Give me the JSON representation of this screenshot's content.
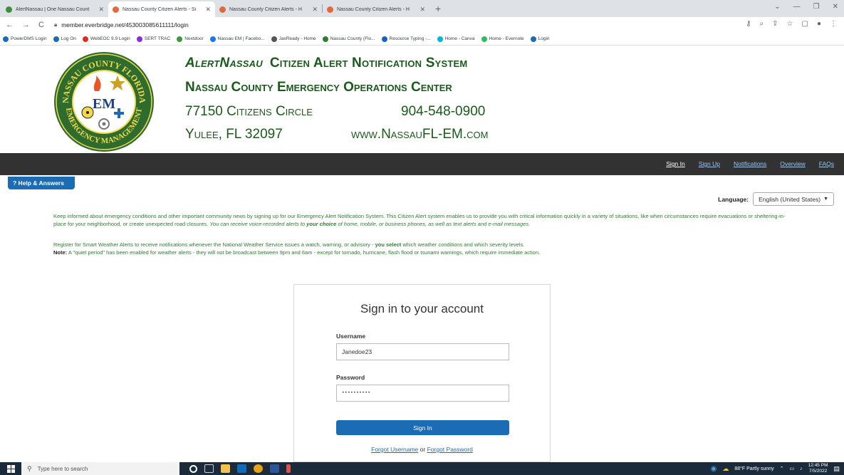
{
  "browser": {
    "tabs": [
      {
        "title": "AlertNassau | One Nassau Count",
        "color": "#3a8f3a",
        "active": false
      },
      {
        "title": "Nassau County Citizen Alerts - Si",
        "color": "#e06a3a",
        "active": true
      },
      {
        "title": "Nassau County Citizen Alerts - H",
        "color": "#e06a3a",
        "active": false
      },
      {
        "title": "Nassau County Citizen Alerts - H",
        "color": "#e06a3a",
        "active": false
      }
    ],
    "url": "member.everbridge.net/453003085611111/login",
    "bookmarks": [
      {
        "label": "PowerDMS Login",
        "color": "#1c6cb5"
      },
      {
        "label": "Log On",
        "color": "#1c6cb5"
      },
      {
        "label": "WebEOC 9.9 Login",
        "color": "#d93025"
      },
      {
        "label": "SERT TRAC",
        "color": "#8a2be2"
      },
      {
        "label": "Nextdoor",
        "color": "#3a9a3a"
      },
      {
        "label": "Nassau EM | Facebo...",
        "color": "#1877f2"
      },
      {
        "label": "JaxReady - Home",
        "color": "#555555"
      },
      {
        "label": "Nassau County (Flo...",
        "color": "#2e7d32"
      },
      {
        "label": "Resource Typing -...",
        "color": "#1565c0"
      },
      {
        "label": "Home - Canva",
        "color": "#00b5d8"
      },
      {
        "label": "Home - Evernote",
        "color": "#2dbe60"
      },
      {
        "label": "Login",
        "color": "#1c6cb5"
      }
    ]
  },
  "header": {
    "brand": "AlertNassau",
    "line1": "Citizen Alert Notification System",
    "line2": "Nassau County Emergency Operations Center",
    "address1": "77150 Citizens Circle",
    "phone": "904-548-0900",
    "address2": "Yulee, FL 32097",
    "website": "www.NassauFL-EM.com",
    "logo_text": {
      "top": "NASSAU COUNTY FLORIDA",
      "bottom": "EMERGENCY MANAGEMENT",
      "center": "EM"
    }
  },
  "nav": {
    "sign_in": "Sign In",
    "sign_up": "Sign Up",
    "notifications": "Notifications",
    "overview": "Overview",
    "faqs": "FAQs"
  },
  "help": {
    "label": "? Help & Answers"
  },
  "language": {
    "label": "Language:",
    "selected": "English (United States)"
  },
  "info": {
    "p1_text": "Keep informed about emergency conditions and other important community news by signing up for our Emergency Alert Notification System.  This Citizen Alert system enables us to provide you with critical information quickly in a variety of situations, like when circumstances require evacuations or sheltering-in-place for your neighborhood, or create unexpected road closures.",
    "p1_italic_a": "You can receive voice-recorded alerts to",
    "p1_bold_italic": "your choice",
    "p1_italic_b": "of home, mobile, or business phones, as well as text alerts and e-mail messages.",
    "p2_text_a": "Register for Smart Weather Alerts to receive notifications whenever the National Weather Service issues a watch, warning, or advisory -",
    "p2_bold": "you select",
    "p2_text_b": "which weather conditions and which severity levels.",
    "note_label": "Note:",
    "note_text": "A \"quiet period\" has been enabled for weather alerts - they will not be broadcast between 9pm and 6am - except for tornado, hurricane, flash flood or tsunami warnings, which require immediate action."
  },
  "signin": {
    "title": "Sign in to your account",
    "username_label": "Username",
    "username_value": "Janedoe23",
    "password_label": "Password",
    "password_value": "••••••••••",
    "button": "Sign In",
    "forgot_username": "Forgot Username",
    "or": "or",
    "forgot_password": "Forgot Password"
  },
  "taskbar": {
    "search_placeholder": "Type here to search",
    "weather": "88°F  Partly sunny",
    "time": "12:45 PM",
    "date": "7/5/2022"
  },
  "colors": {
    "brand_green": "#1a5a1a",
    "info_green": "#2f7d2f",
    "primary_blue": "#1c6cb5",
    "navbar": "#323232"
  }
}
